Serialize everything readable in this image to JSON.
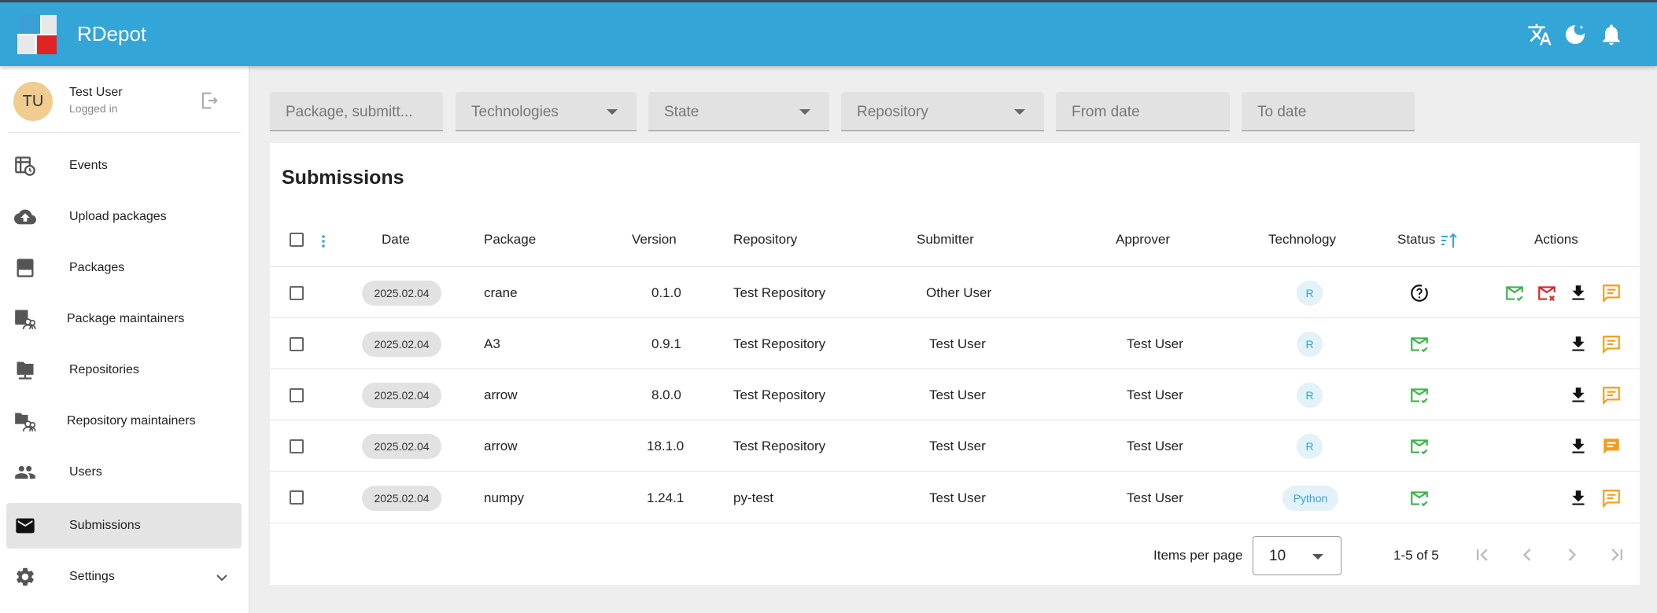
{
  "app": {
    "title": "RDepot"
  },
  "header": {
    "icons": [
      "translate-icon",
      "dark-mode-icon",
      "notifications-icon"
    ]
  },
  "user": {
    "initials": "TU",
    "name": "Test User",
    "status": "Logged in"
  },
  "sidebar": {
    "items": [
      {
        "label": "Events",
        "icon": "events-icon"
      },
      {
        "label": "Upload packages",
        "icon": "cloud-upload-icon"
      },
      {
        "label": "Packages",
        "icon": "packages-icon"
      },
      {
        "label": "Package maintainers",
        "icon": "package-maintainers-icon"
      },
      {
        "label": "Repositories",
        "icon": "folder-network-icon"
      },
      {
        "label": "Repository maintainers",
        "icon": "repository-maintainers-icon"
      },
      {
        "label": "Users",
        "icon": "users-icon"
      },
      {
        "label": "Submissions",
        "icon": "mail-icon",
        "active": true
      },
      {
        "label": "Settings",
        "icon": "gear-icon"
      }
    ]
  },
  "filters": {
    "search": "Package, submitt...",
    "technologies": "Technologies",
    "state": "State",
    "repository": "Repository",
    "from_date": "From date",
    "to_date": "To date"
  },
  "table": {
    "title": "Submissions",
    "columns": [
      "Date",
      "Package",
      "Version",
      "Repository",
      "Submitter",
      "Approver",
      "Technology",
      "Status",
      "Actions"
    ],
    "rows": [
      {
        "date": "2025.02.04",
        "package": "crane",
        "version": "0.1.0",
        "repository": "Test Repository",
        "submitter": "Other User",
        "approver": "",
        "technology": "R",
        "status": "waiting"
      },
      {
        "date": "2025.02.04",
        "package": "A3",
        "version": "0.9.1",
        "repository": "Test Repository",
        "submitter": "Test User",
        "approver": "Test User",
        "technology": "R",
        "status": "accepted"
      },
      {
        "date": "2025.02.04",
        "package": "arrow",
        "version": "8.0.0",
        "repository": "Test Repository",
        "submitter": "Test User",
        "approver": "Test User",
        "technology": "R",
        "status": "accepted"
      },
      {
        "date": "2025.02.04",
        "package": "arrow",
        "version": "18.1.0",
        "repository": "Test Repository",
        "submitter": "Test User",
        "approver": "Test User",
        "technology": "R",
        "status": "accepted"
      },
      {
        "date": "2025.02.04",
        "package": "numpy",
        "version": "1.24.1",
        "repository": "py-test",
        "submitter": "Test User",
        "approver": "Test User",
        "technology": "Python",
        "status": "accepted"
      }
    ]
  },
  "pagination": {
    "label": "Items per page",
    "per_page": "10",
    "range": "1-5 of 5"
  },
  "colors": {
    "primary": "#33a5d6",
    "success": "#3ab54a",
    "danger": "#e02424",
    "warning": "#f29d1c"
  }
}
